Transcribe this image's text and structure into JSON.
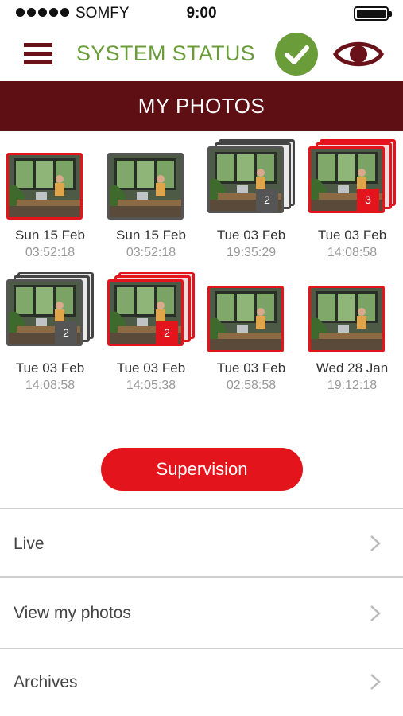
{
  "status_bar": {
    "carrier": "SOMFY",
    "time": "9:00"
  },
  "header": {
    "title": "SYSTEM STATUS",
    "status_color": "#6a9d3a",
    "brand_color": "#6a1219"
  },
  "section": {
    "title": "MY PHOTOS"
  },
  "photos": [
    {
      "date": "Sun 15 Feb",
      "time": "03:52:18",
      "count": null,
      "style": "red"
    },
    {
      "date": "Sun 15 Feb",
      "time": "03:52:18",
      "count": null,
      "style": "gray"
    },
    {
      "date": "Tue 03 Feb",
      "time": "19:35:29",
      "count": "2",
      "style": "gray"
    },
    {
      "date": "Tue 03 Feb",
      "time": "14:08:58",
      "count": "3",
      "style": "red"
    },
    {
      "date": "Tue 03 Feb",
      "time": "14:08:58",
      "count": "2",
      "style": "gray"
    },
    {
      "date": "Tue 03 Feb",
      "time": "14:05:38",
      "count": "2",
      "style": "red"
    },
    {
      "date": "Tue 03 Feb",
      "time": "02:58:58",
      "count": null,
      "style": "red"
    },
    {
      "date": "Wed 28 Jan",
      "time": "19:12:18",
      "count": null,
      "style": "red"
    }
  ],
  "supervision_button": {
    "label": "Supervision",
    "color": "#e3141c"
  },
  "menu": {
    "items": [
      {
        "label": "Live"
      },
      {
        "label": "View my photos"
      },
      {
        "label": "Archives"
      }
    ]
  }
}
